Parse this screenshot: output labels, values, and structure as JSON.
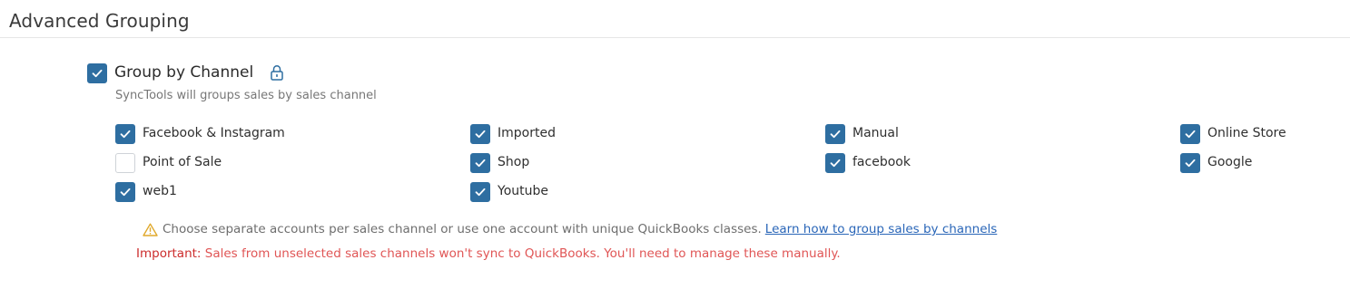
{
  "section": {
    "title": "Advanced Grouping"
  },
  "group_by_channel": {
    "label": "Group by Channel",
    "checked": true,
    "subtitle": "SyncTools will groups sales by sales channel",
    "lock_icon": "lock-icon"
  },
  "channels": [
    {
      "label": "Facebook & Instagram",
      "checked": true
    },
    {
      "label": "Imported",
      "checked": true
    },
    {
      "label": "Manual",
      "checked": true
    },
    {
      "label": "Online Store",
      "checked": true
    },
    {
      "label": "Point of Sale",
      "checked": false
    },
    {
      "label": "Shop",
      "checked": true
    },
    {
      "label": "facebook",
      "checked": true
    },
    {
      "label": "Google",
      "checked": true
    },
    {
      "label": "web1",
      "checked": true
    },
    {
      "label": "Youtube",
      "checked": true
    }
  ],
  "notice": {
    "text": "Choose separate accounts per sales channel or use one account with unique QuickBooks classes.",
    "link_text": "Learn how to group sales by channels",
    "icon": "warning-icon"
  },
  "important": {
    "lead": "Important:",
    "text": "Sales from unselected sales channels won't sync to QuickBooks. You'll need to manage these manually."
  },
  "colors": {
    "accent": "#2e6ea1",
    "link": "#2a66b8",
    "warning": "#e0a92c",
    "danger": "#cc2c2c"
  }
}
